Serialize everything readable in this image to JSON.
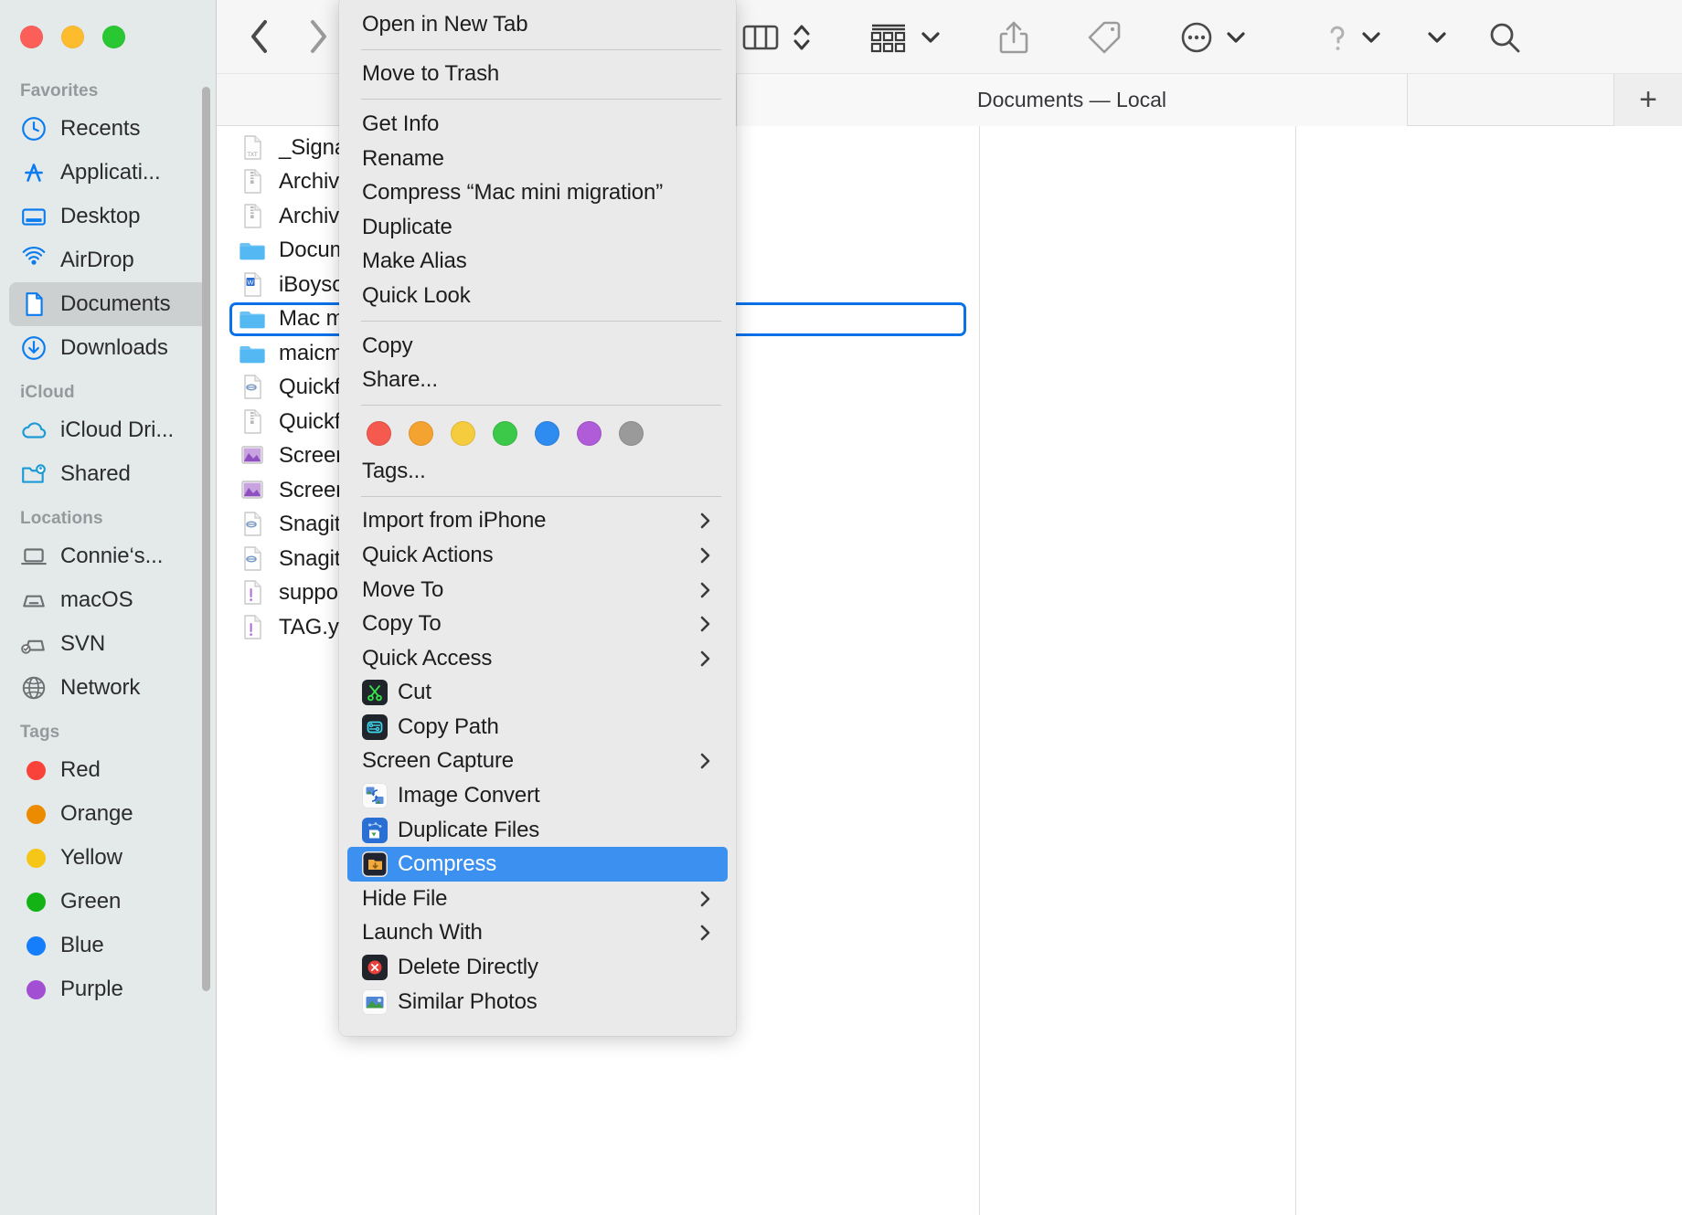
{
  "window": {
    "title": "Documents — Local",
    "traffic_lights": [
      {
        "name": "close",
        "color": "#fb5f57"
      },
      {
        "name": "minimize",
        "color": "#fcbc2d"
      },
      {
        "name": "zoom",
        "color": "#29c732"
      }
    ]
  },
  "toolbar": {
    "back_label": "Back",
    "forward_label": "Forward",
    "view_column_label": "Column View",
    "view_stepper_label": "View Options",
    "group_label": "Group By",
    "share_label": "Share",
    "tag_label": "Add Tags",
    "more_label": "More",
    "help_label": "Help",
    "chevron_label": "Show More",
    "search_label": "Search"
  },
  "tabbar": {
    "active_tab": "Documents — Local",
    "new_tab_label": "+"
  },
  "sidebar": {
    "groups": [
      {
        "title": "Favorites",
        "items": [
          {
            "label": "Recents",
            "icon": "clock-icon",
            "selected": false
          },
          {
            "label": "Applicati...",
            "icon": "applications-icon",
            "selected": false
          },
          {
            "label": "Desktop",
            "icon": "desktop-icon",
            "selected": false
          },
          {
            "label": "AirDrop",
            "icon": "airdrop-icon",
            "selected": false
          },
          {
            "label": "Documents",
            "icon": "document-icon",
            "selected": true
          },
          {
            "label": "Downloads",
            "icon": "downloads-icon",
            "selected": false
          }
        ]
      },
      {
        "title": "iCloud",
        "items": [
          {
            "label": "iCloud Dri...",
            "icon": "cloud-icon",
            "selected": false
          },
          {
            "label": "Shared",
            "icon": "shared-folder-icon",
            "selected": false
          }
        ]
      },
      {
        "title": "Locations",
        "items": [
          {
            "label": "Connie‘s...",
            "icon": "laptop-icon",
            "selected": false
          },
          {
            "label": "macOS",
            "icon": "harddisk-icon",
            "selected": false
          },
          {
            "label": "SVN",
            "icon": "external-disk-icon",
            "selected": false
          },
          {
            "label": "Network",
            "icon": "globe-icon",
            "selected": false
          }
        ]
      },
      {
        "title": "Tags",
        "items": [
          {
            "label": "Red",
            "icon": "tag-dot-icon",
            "color": "#f9423a",
            "selected": false
          },
          {
            "label": "Orange",
            "icon": "tag-dot-icon",
            "color": "#ed8b00",
            "selected": false
          },
          {
            "label": "Yellow",
            "icon": "tag-dot-icon",
            "color": "#f5c518",
            "selected": false
          },
          {
            "label": "Green",
            "icon": "tag-dot-icon",
            "color": "#13b316",
            "selected": false
          },
          {
            "label": "Blue",
            "icon": "tag-dot-icon",
            "color": "#147efb",
            "selected": false
          },
          {
            "label": "Purple",
            "icon": "tag-dot-icon",
            "color": "#a34fd4",
            "selected": false
          }
        ]
      }
    ]
  },
  "filelist": {
    "rows": [
      {
        "name": "_Signat",
        "icon": "txt-file-icon",
        "selected": false
      },
      {
        "name": "Archive",
        "icon": "zip-file-icon",
        "selected": false
      },
      {
        "name": "Archive",
        "icon": "zip-file-icon",
        "selected": false
      },
      {
        "name": "Docum",
        "icon": "folder-icon",
        "selected": false
      },
      {
        "name": "iBoysof",
        "icon": "word-file-icon",
        "selected": false
      },
      {
        "name": "Mac mi",
        "icon": "folder-icon",
        "selected": true
      },
      {
        "name": "maicme",
        "icon": "folder-icon",
        "selected": false
      },
      {
        "name": "Quickfo",
        "icon": "generic-file-icon",
        "selected": false
      },
      {
        "name": "Quickfo",
        "icon": "zip-file-icon",
        "selected": false
      },
      {
        "name": "Screen",
        "icon": "image-file-icon",
        "selected": false
      },
      {
        "name": "Screen",
        "icon": "image-file-icon",
        "selected": false
      },
      {
        "name": "Snagit.",
        "icon": "generic-file-icon",
        "selected": false
      },
      {
        "name": "Snagit.",
        "icon": "generic-file-icon",
        "selected": false
      },
      {
        "name": "suppor",
        "icon": "alert-file-icon",
        "selected": false
      },
      {
        "name": "TAG.ya",
        "icon": "alert-file-icon",
        "selected": false
      }
    ]
  },
  "context_menu": {
    "highlight_color": "#3b90f0",
    "tag_colors": [
      {
        "name": "red",
        "color": "#f45a4e"
      },
      {
        "name": "orange",
        "color": "#f5a330"
      },
      {
        "name": "yellow",
        "color": "#f6cc3f"
      },
      {
        "name": "green",
        "color": "#3cc94a"
      },
      {
        "name": "blue",
        "color": "#2e8bf0"
      },
      {
        "name": "purple",
        "color": "#b05bd8"
      },
      {
        "name": "gray",
        "color": "#9a9a9a"
      }
    ],
    "tags_picker_label": "Tags...",
    "sections": [
      {
        "items": [
          {
            "label": "Open in New Tab",
            "submenu": false,
            "icon": null,
            "highlighted": false
          }
        ]
      },
      {
        "items": [
          {
            "label": "Move to Trash",
            "submenu": false,
            "icon": null,
            "highlighted": false
          }
        ]
      },
      {
        "items": [
          {
            "label": "Get Info",
            "submenu": false,
            "icon": null,
            "highlighted": false
          },
          {
            "label": "Rename",
            "submenu": false,
            "icon": null,
            "highlighted": false
          },
          {
            "label": "Compress “Mac mini migration”",
            "submenu": false,
            "icon": null,
            "highlighted": false
          },
          {
            "label": "Duplicate",
            "submenu": false,
            "icon": null,
            "highlighted": false
          },
          {
            "label": "Make Alias",
            "submenu": false,
            "icon": null,
            "highlighted": false
          },
          {
            "label": "Quick Look",
            "submenu": false,
            "icon": null,
            "highlighted": false
          }
        ]
      },
      {
        "items": [
          {
            "label": "Copy",
            "submenu": false,
            "icon": null,
            "highlighted": false
          },
          {
            "label": "Share...",
            "submenu": false,
            "icon": null,
            "highlighted": false
          }
        ]
      },
      {
        "colors": true,
        "items": [
          {
            "label": "Tags...",
            "submenu": false,
            "icon": null,
            "highlighted": false
          }
        ]
      },
      {
        "items": [
          {
            "label": "Import from iPhone",
            "submenu": true,
            "icon": null,
            "highlighted": false
          },
          {
            "label": "Quick Actions",
            "submenu": true,
            "icon": null,
            "highlighted": false
          },
          {
            "label": "Move To",
            "submenu": true,
            "icon": null,
            "highlighted": false
          },
          {
            "label": "Copy To",
            "submenu": true,
            "icon": null,
            "highlighted": false
          },
          {
            "label": "Quick Access",
            "submenu": true,
            "icon": null,
            "highlighted": false
          },
          {
            "label": "Cut",
            "submenu": false,
            "icon": "cut-icon",
            "highlighted": false
          },
          {
            "label": "Copy Path",
            "submenu": false,
            "icon": "copy-path-icon",
            "highlighted": false
          },
          {
            "label": "Screen Capture",
            "submenu": true,
            "icon": null,
            "highlighted": false
          },
          {
            "label": "Image Convert",
            "submenu": false,
            "icon": "image-convert-icon",
            "highlighted": false
          },
          {
            "label": "Duplicate Files",
            "submenu": false,
            "icon": "duplicate-files-icon",
            "highlighted": false
          },
          {
            "label": "Compress",
            "submenu": false,
            "icon": "compress-icon",
            "highlighted": true
          },
          {
            "label": "Hide File",
            "submenu": true,
            "icon": null,
            "highlighted": false
          },
          {
            "label": "Launch With",
            "submenu": true,
            "icon": null,
            "highlighted": false
          },
          {
            "label": "Delete Directly",
            "submenu": false,
            "icon": "delete-directly-icon",
            "highlighted": false
          },
          {
            "label": "Similar Photos",
            "submenu": false,
            "icon": "similar-photos-icon",
            "highlighted": false
          }
        ]
      }
    ]
  }
}
